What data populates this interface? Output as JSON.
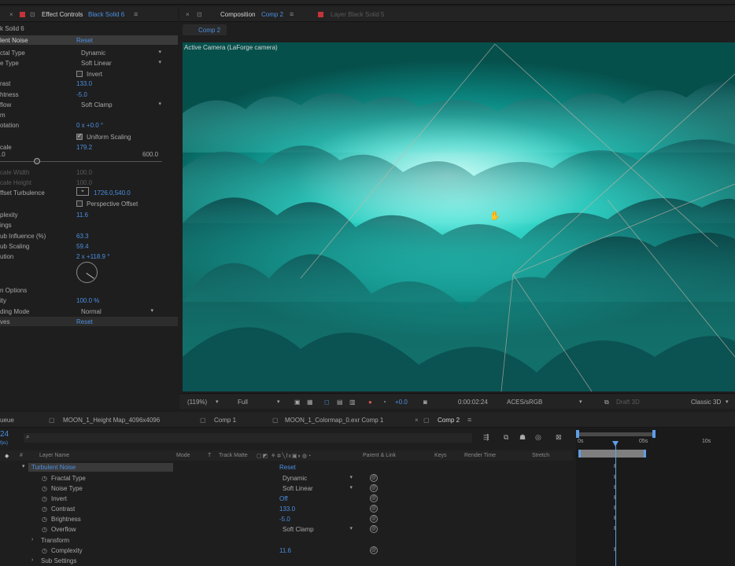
{
  "effect_controls": {
    "tab_prefix": "Effect Controls",
    "tab_layer": "Black Solid 6",
    "layer_header": "k Solid 6",
    "effect_name": "lent Noise",
    "reset_label": "Reset",
    "rows": [
      {
        "label": "ctal Type",
        "value": "Dynamic",
        "kind": "select"
      },
      {
        "label": "e Type",
        "value": "Soft Linear",
        "kind": "select"
      },
      {
        "label": "",
        "value": "Invert",
        "kind": "checkbox"
      },
      {
        "label": "rast",
        "value": "133.0",
        "kind": "value"
      },
      {
        "label": "htness",
        "value": "-5.0",
        "kind": "value"
      },
      {
        "label": "flow",
        "value": "Soft Clamp",
        "kind": "select"
      },
      {
        "label": "m",
        "value": "",
        "kind": "header"
      },
      {
        "label": "otation",
        "value": "0 x +0.0 °",
        "kind": "value"
      },
      {
        "label": "",
        "value": "Uniform Scaling",
        "kind": "checkbox-on"
      },
      {
        "label": "cale",
        "value": "179.2",
        "kind": "value"
      }
    ],
    "slider_min": ".0",
    "slider_max": "600.0",
    "slider_level": 0.23,
    "dim_rows": [
      "cale Width",
      "cale Height"
    ],
    "dim_values": [
      "100.0",
      "100.0"
    ],
    "offset_label": "ffset Turbulence",
    "offset_value": "1726.0,540.0",
    "perspective_label": "Perspective Offset",
    "rows2": [
      {
        "label": "plexity",
        "value": "11.6"
      },
      {
        "label": "ings",
        "value": ""
      },
      {
        "label": "ub Influence (%)",
        "value": "63.3"
      },
      {
        "label": "ub Scaling",
        "value": "59.4"
      },
      {
        "label": "ution",
        "value": "2 x +118.9 °"
      }
    ],
    "options_label": "n Options",
    "opacity_label": "ity",
    "opacity_value": "100.0 %",
    "blend_label": "ding Mode",
    "blend_value": "Normal",
    "curves_label": "ves",
    "curves_reset": "Reset"
  },
  "composition": {
    "tab_prefix": "Composition",
    "tab_comp": "Comp 2",
    "layer_tab": "Layer Black Solid 5",
    "sub_tab": "Comp 2",
    "viewer_label": "Active Camera (LaForge camera)",
    "footer": {
      "zoom": "(119%)",
      "resolution": "Full",
      "exposure": "+0.0",
      "timecode": "0:00:02:24",
      "color": "ACES/sRGB",
      "renderer_label": "Draft 3D",
      "renderer": "Classic 3D"
    }
  },
  "timeline": {
    "tabs": [
      {
        "label": "ueue"
      },
      {
        "label": "MOON_1_Height Map_4096x4096"
      },
      {
        "label": "Comp 1"
      },
      {
        "label": "MOON_1_Colormap_0.exr Comp 1"
      },
      {
        "label": "Comp 2"
      }
    ],
    "time_display": "24",
    "time_sub": "fps)",
    "columns": {
      "hash": "#",
      "layer_name": "Layer Name",
      "mode": "Mode",
      "t": "T",
      "track_matte": "Track Matte",
      "parent_link": "Parent & Link",
      "keys": "Keys",
      "render_time": "Render Time",
      "stretch": "Stretch"
    },
    "effect_row": "Turbulent Noise",
    "effect_reset": "Reset",
    "rows": [
      {
        "name": "Fractal Type",
        "value": "Dynamic",
        "kind": "select"
      },
      {
        "name": "Noise Type",
        "value": "Soft Linear",
        "kind": "select"
      },
      {
        "name": "Invert",
        "value": "Off",
        "kind": "value"
      },
      {
        "name": "Contrast",
        "value": "133.0",
        "kind": "value"
      },
      {
        "name": "Brightness",
        "value": "-5.0",
        "kind": "value"
      },
      {
        "name": "Overflow",
        "value": "Soft Clamp",
        "kind": "select"
      },
      {
        "name": "Transform",
        "value": "",
        "kind": "group"
      },
      {
        "name": "Complexity",
        "value": "11.6",
        "kind": "value"
      },
      {
        "name": "Sub Settings",
        "value": "",
        "kind": "group"
      }
    ],
    "ruler": [
      "0s",
      "05s",
      "10s"
    ]
  }
}
